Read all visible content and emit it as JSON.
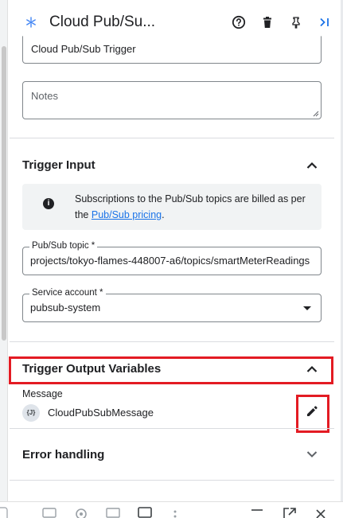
{
  "header": {
    "title": "Cloud Pub/Su...",
    "icons": [
      "pubsub-icon",
      "help-icon",
      "delete-icon",
      "pin-icon",
      "collapse-panel-icon"
    ]
  },
  "fields": {
    "name_value": "Cloud Pub/Sub Trigger",
    "notes_placeholder": "Notes"
  },
  "trigger_input": {
    "title": "Trigger Input",
    "info_text": "Subscriptions to the Pub/Sub topics are billed as per the ",
    "info_link": "Pub/Sub pricing",
    "info_suffix": ".",
    "topic_label": "Pub/Sub topic *",
    "topic_value": "projects/tokyo-flames-448007-a6/topics/smartMeterReadings",
    "service_account_label": "Service account *",
    "service_account_value": "pubsub-system"
  },
  "trigger_output": {
    "title": "Trigger Output Variables",
    "message_label": "Message",
    "chip_text": "{J}",
    "message_value": "CloudPubSubMessage"
  },
  "error_handling": {
    "title": "Error handling"
  },
  "colors": {
    "accent": "#1a73e8",
    "highlight": "#e31b23",
    "info_background": "#f1f3f4"
  }
}
